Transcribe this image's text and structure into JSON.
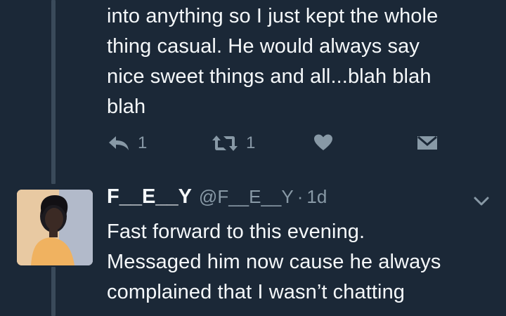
{
  "previous_tweet": {
    "text_lines": [
      "into anything so I just kept the whole",
      "thing casual. He would always say",
      "nice sweet things and all...blah blah",
      "blah"
    ],
    "actions": {
      "reply_count": "1",
      "retweet_count": "1"
    }
  },
  "tweet": {
    "display_name": "F__E__Y",
    "handle": "@F__E__Y",
    "separator": "·",
    "timestamp": "1d",
    "text_lines": [
      "Fast forward to this evening.",
      "Messaged him now cause he always",
      "complained that I wasn’t chatting"
    ]
  },
  "icons": {
    "reply": "reply-icon",
    "retweet": "retweet-icon",
    "like": "heart-icon",
    "dm": "envelope-icon",
    "menu": "chevron-down-icon"
  },
  "colors": {
    "background": "#1b2837",
    "text": "#f5f8fa",
    "muted": "#8899a6",
    "thread_line": "#3a4a5a"
  }
}
